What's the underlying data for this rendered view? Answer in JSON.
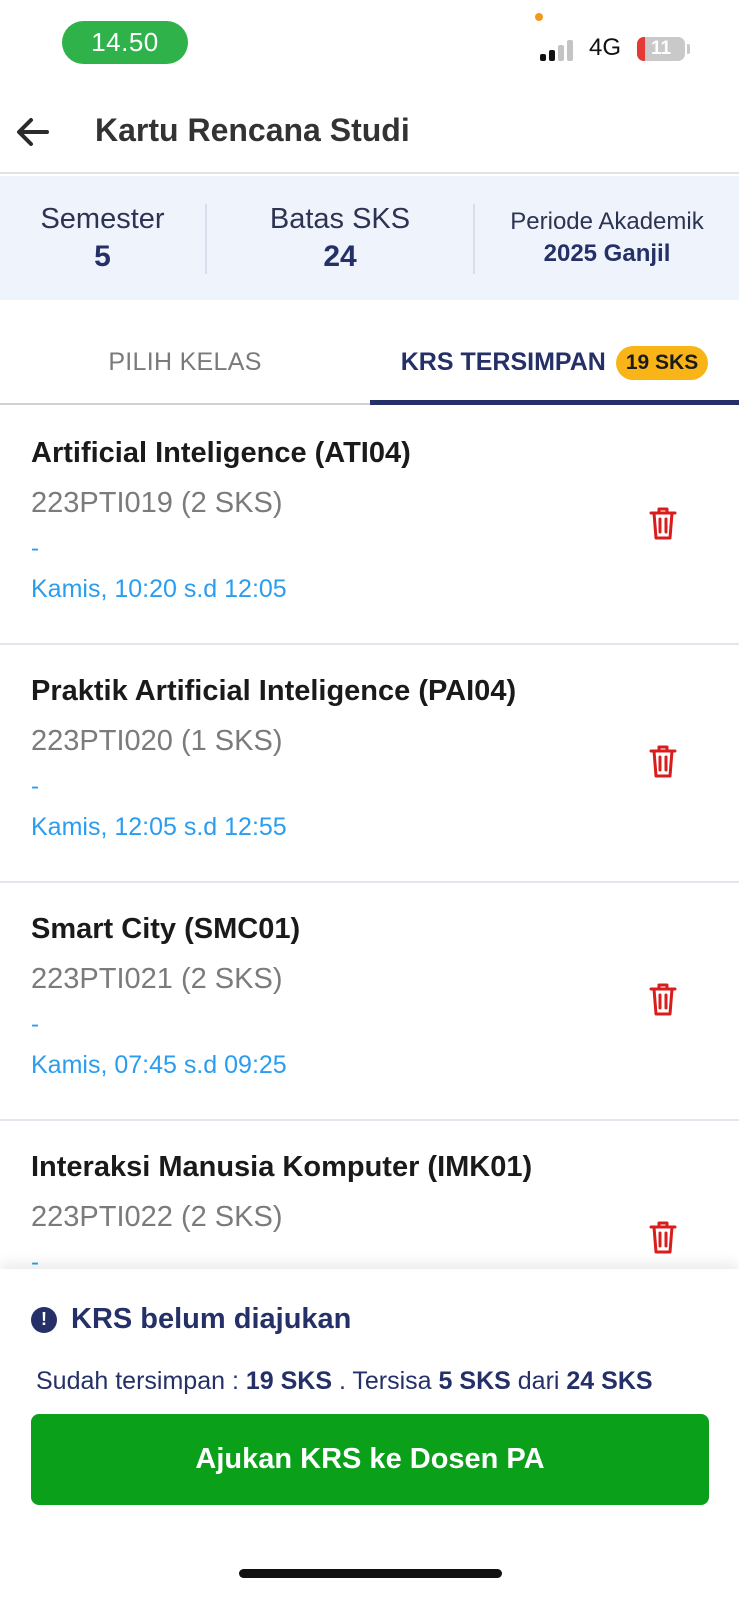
{
  "status_bar": {
    "time": "14.50",
    "network": "4G",
    "battery": "11",
    "colors": {
      "time_pill": "#2fb24a",
      "battery_low": "#e53935"
    }
  },
  "header": {
    "back_icon": "arrow-left-icon",
    "title": "Kartu Rencana Studi"
  },
  "summary": {
    "semester_label": "Semester",
    "semester_value": "5",
    "batas_label": "Batas SKS",
    "batas_value": "24",
    "periode_label": "Periode Akademik",
    "periode_value": "2025 Ganjil"
  },
  "tabs": {
    "pilih_label": "PILIH KELAS",
    "krs_label": "KRS TERSIMPAN",
    "krs_badge": "19 SKS",
    "active": "krs"
  },
  "courses": [
    {
      "name": "Artificial Inteligence (ATI04)",
      "code": "223PTI019 (2 SKS)",
      "lecturer": "-",
      "schedule": "Kamis, 10:20 s.d 12:05"
    },
    {
      "name": "Praktik Artificial Inteligence (PAI04)",
      "code": "223PTI020 (1 SKS)",
      "lecturer": "-",
      "schedule": "Kamis, 12:05 s.d 12:55"
    },
    {
      "name": "Smart City (SMC01)",
      "code": "223PTI021 (2 SKS)",
      "lecturer": "-",
      "schedule": "Kamis, 07:45 s.d 09:25"
    },
    {
      "name": "Interaksi Manusia Komputer (IMK01)",
      "code": "223PTI022 (2 SKS)",
      "lecturer": "-",
      "schedule": ""
    }
  ],
  "footer": {
    "alert_icon": "exclamation-circle-icon",
    "alert_text": "KRS belum diajukan",
    "info_prefix": "Sudah tersimpan : ",
    "info_saved": "19 SKS",
    "info_mid": " . Tersisa ",
    "info_remaining": "5 SKS",
    "info_dari": " dari ",
    "info_total": "24 SKS",
    "submit_label": "Ajukan KRS ke Dosen PA",
    "colors": {
      "primary": "#243067",
      "submit": "#0aa01a",
      "schedule": "#2a9df0",
      "delete": "#d91c1c",
      "badge": "#f9b417"
    }
  }
}
